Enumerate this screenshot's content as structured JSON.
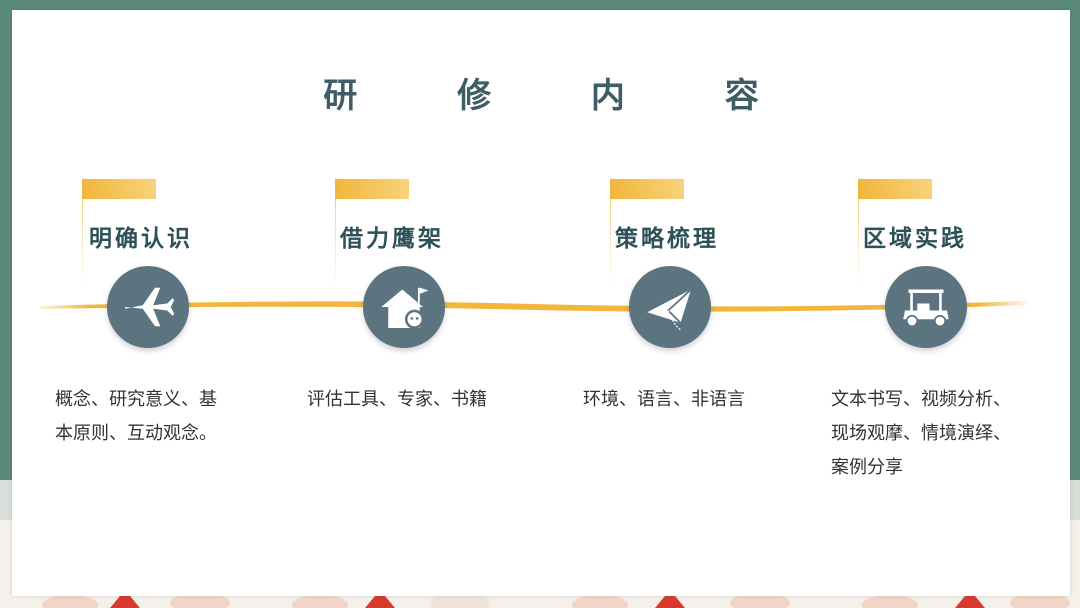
{
  "slide": {
    "title": "研 修 内 容"
  },
  "stages": [
    {
      "title": "明确认识",
      "icon": "airplane-icon",
      "description_lines": [
        "概念、研究意义、基",
        "本原则、互动观念。"
      ]
    },
    {
      "title": "借力鹰架",
      "icon": "house-with-flag-icon",
      "description_lines": [
        "评估工具、专家、书籍"
      ]
    },
    {
      "title": "策略梳理",
      "icon": "paper-plane-icon",
      "description_lines": [
        "环境、语言、非语言"
      ]
    },
    {
      "title": "区域实践",
      "icon": "golf-cart-icon",
      "description_lines": [
        "文本书写、视频分析、",
        "现场观摩、情境演绎、",
        "案例分享"
      ]
    }
  ],
  "colors": {
    "background_green": "#5b8a7a",
    "title_text": "#3f5d66",
    "stage_title_text": "#2d5157",
    "icon_circle": "#5b7480",
    "timeline_accent": "#f2b63c",
    "body_text": "#333333"
  }
}
